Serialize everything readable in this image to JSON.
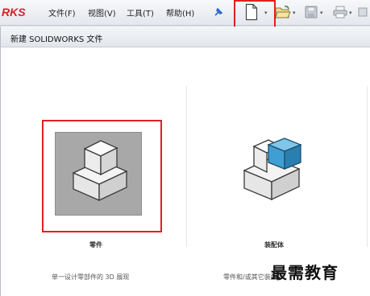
{
  "app": {
    "logo_text": "RKS"
  },
  "menu": [
    {
      "label": "文件(F)"
    },
    {
      "label": "视图(V)"
    },
    {
      "label": "工具(T)"
    },
    {
      "label": "帮助(H)"
    }
  ],
  "toolbar": {
    "icons": [
      "pin-icon",
      "new-document-icon",
      "open-folder-icon",
      "save-icon",
      "print-icon"
    ]
  },
  "dialog": {
    "title": "新建 SOLIDWORKS 文件",
    "templates": [
      {
        "label": "零件",
        "description": "单一设计零部件的 3D 展现"
      },
      {
        "label": "装配体",
        "description": "零件和/或其它装配体"
      }
    ]
  },
  "watermark": {
    "text": "最需教育"
  },
  "colors": {
    "highlight": "#e02020",
    "selected_tile": "#a8a8a8",
    "logo": "#d2232a"
  }
}
